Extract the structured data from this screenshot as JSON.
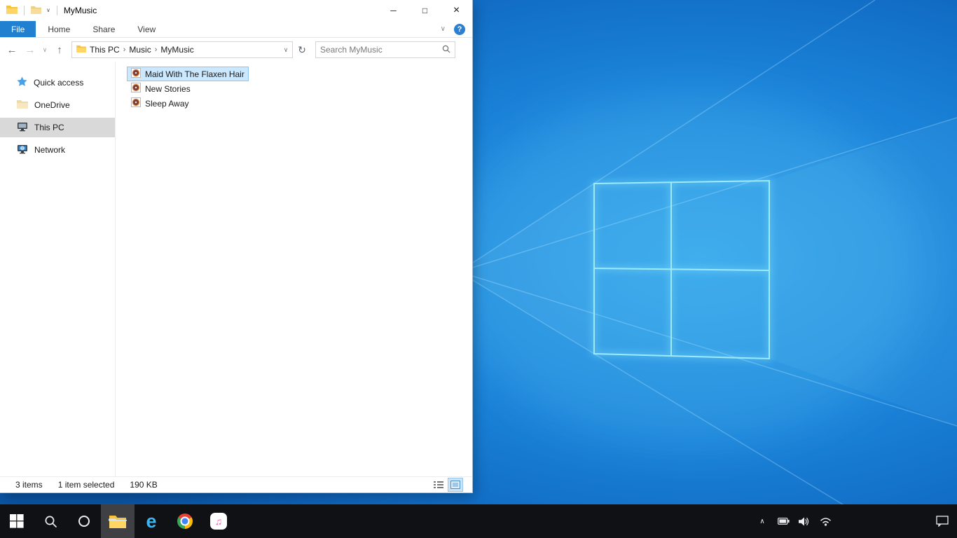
{
  "explorer": {
    "title": "MyMusic",
    "window_controls": {
      "minimize": "─",
      "maximize": "□",
      "close": "×"
    },
    "ribbon": {
      "file_tab": "File",
      "tabs": [
        "Home",
        "Share",
        "View"
      ]
    },
    "navigation": {
      "breadcrumb": [
        "This PC",
        "Music",
        "MyMusic"
      ],
      "search_placeholder": "Search MyMusic"
    },
    "sidebar": [
      {
        "label": "Quick access"
      },
      {
        "label": "OneDrive"
      },
      {
        "label": "This PC"
      },
      {
        "label": "Network"
      }
    ],
    "files": [
      {
        "name": "Maid With The Flaxen Hair",
        "selected": true
      },
      {
        "name": "New Stories",
        "selected": false
      },
      {
        "name": "Sleep Away",
        "selected": false
      }
    ],
    "status": {
      "items": "3 items",
      "selected": "1 item selected",
      "size": "190 KB"
    }
  },
  "icons": {
    "back": "←",
    "forward": "→",
    "history_chevron": "∨",
    "up": "↑",
    "address_chevron": "∨",
    "refresh": "↻",
    "ribbon_collapse": "∨",
    "help": "?",
    "qat_chevron": "∨",
    "breadcrumb_sep": "›",
    "tray_chevron": "∧"
  },
  "taskbar": {
    "edge_glyph": "e",
    "itunes_glyph": "♫"
  },
  "colors": {
    "accent": "#2181d0",
    "selection_bg": "#cce8ff",
    "selection_border": "#8ec6f2",
    "taskbar_bg": "#101114"
  }
}
